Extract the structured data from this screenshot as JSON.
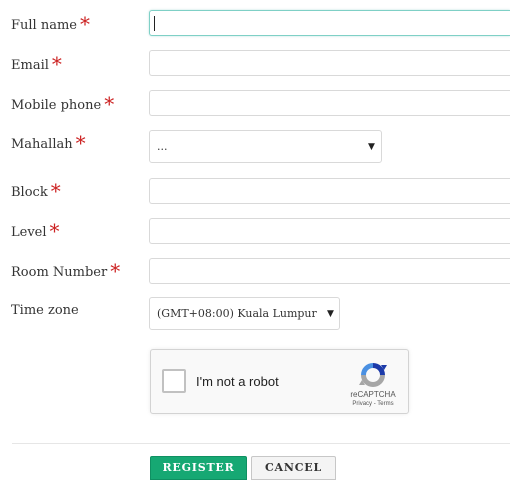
{
  "form": {
    "fields": [
      {
        "label": "Full name",
        "required_mark": "*",
        "value": ""
      },
      {
        "label": "Email",
        "required_mark": "*",
        "value": ""
      },
      {
        "label": "Mobile phone",
        "required_mark": "*",
        "value": ""
      },
      {
        "label": "Mahallah",
        "required_mark": "*",
        "selected": "..."
      },
      {
        "label": "Block",
        "required_mark": "*",
        "value": ""
      },
      {
        "label": "Level",
        "required_mark": "*",
        "value": ""
      },
      {
        "label": "Room Number",
        "required_mark": "*",
        "value": ""
      },
      {
        "label": "Time zone",
        "selected": "(GMT+08:00) Kuala Lumpur"
      }
    ],
    "dropdown_arrow": "▼"
  },
  "captcha": {
    "label": "I'm not a robot",
    "brand": "reCAPTCHA",
    "links": "Privacy - Terms",
    "checked": false
  },
  "buttons": {
    "register": "REGISTER",
    "cancel": "CANCEL"
  },
  "colors": {
    "required": "#cc2222",
    "register_bg": "#16a873",
    "focus_border": "#7fd0c6"
  },
  "icons": {
    "captcha_logo": "recaptcha-logo-icon",
    "dropdown": "chevron-down-icon"
  }
}
